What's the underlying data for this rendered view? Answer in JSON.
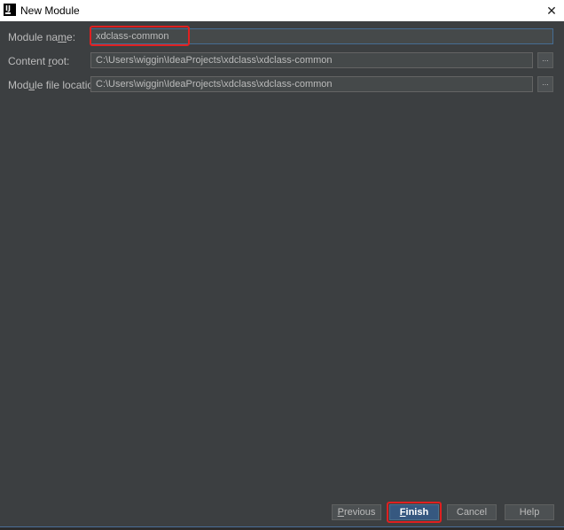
{
  "window": {
    "title": "New Module",
    "app_icon_letter": "IJ",
    "close_glyph": "✕"
  },
  "form": {
    "module_name": {
      "label_pre": "Module na",
      "label_mnemonic": "m",
      "label_post": "e:",
      "value": "xdclass-common"
    },
    "content_root": {
      "label_pre": "Content ",
      "label_mnemonic": "r",
      "label_post": "oot:",
      "value": "C:\\Users\\wiggin\\IdeaProjects\\xdclass\\xdclass-common",
      "browse_label": "..."
    },
    "module_file_location": {
      "label_pre": "Mod",
      "label_mnemonic": "u",
      "label_post": "le file location:",
      "value": "C:\\Users\\wiggin\\IdeaProjects\\xdclass\\xdclass-common",
      "browse_label": "..."
    }
  },
  "buttons": {
    "previous": {
      "mnemonic": "P",
      "rest": "revious"
    },
    "finish": {
      "mnemonic": "F",
      "rest": "inish"
    },
    "cancel": {
      "label": "Cancel"
    },
    "help": {
      "label": "Help"
    }
  },
  "colors": {
    "dialog_bg": "#3c3f41",
    "field_bg": "#45494a",
    "label_text": "#bbbbbb",
    "annotation_red": "#e02020",
    "default_button": "#365880"
  },
  "icons": {
    "app": "intellij-idea-icon",
    "close": "close-icon"
  }
}
